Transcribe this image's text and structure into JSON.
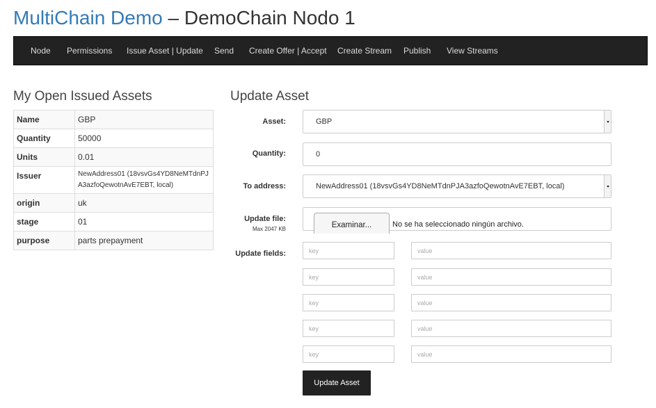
{
  "header": {
    "brand": "MultiChain Demo",
    "subtitle": "– DemoChain Nodo 1"
  },
  "nav": {
    "items": [
      {
        "label": "Node"
      },
      {
        "label": "Permissions"
      },
      {
        "label": "Issue Asset | Update"
      },
      {
        "label": "Send"
      },
      {
        "label": "Create Offer | Accept"
      },
      {
        "label": "Create Stream"
      },
      {
        "label": "Publish"
      },
      {
        "label": "View Streams"
      }
    ]
  },
  "assets_panel": {
    "heading": "My Open Issued Assets",
    "rows": [
      {
        "key": "Name",
        "value": "GBP"
      },
      {
        "key": "Quantity",
        "value": "50000"
      },
      {
        "key": "Units",
        "value": "0.01"
      },
      {
        "key": "Issuer",
        "value": "NewAddress01 (18vsvGs4YD8NeMTdnPJA3azfoQewotnAvE7EBT, local)"
      },
      {
        "key": "origin",
        "value": "uk"
      },
      {
        "key": "stage",
        "value": "01"
      },
      {
        "key": "purpose",
        "value": "parts prepayment"
      }
    ]
  },
  "update_form": {
    "heading": "Update Asset",
    "asset_label": "Asset:",
    "asset_value": "GBP",
    "quantity_label": "Quantity:",
    "quantity_value": "0",
    "to_label": "To address:",
    "to_value": "NewAddress01 (18vsvGs4YD8NeMTdnPJA3azfoQewotnAvE7EBT, local)",
    "file_label": "Update file:",
    "file_hint": "Max 2047 KB",
    "file_button": "Examinar...",
    "file_status": "No se ha seleccionado ningún archivo.",
    "fields_label": "Update fields:",
    "key_placeholder": "key",
    "value_placeholder": "value",
    "submit_label": "Update Asset"
  }
}
